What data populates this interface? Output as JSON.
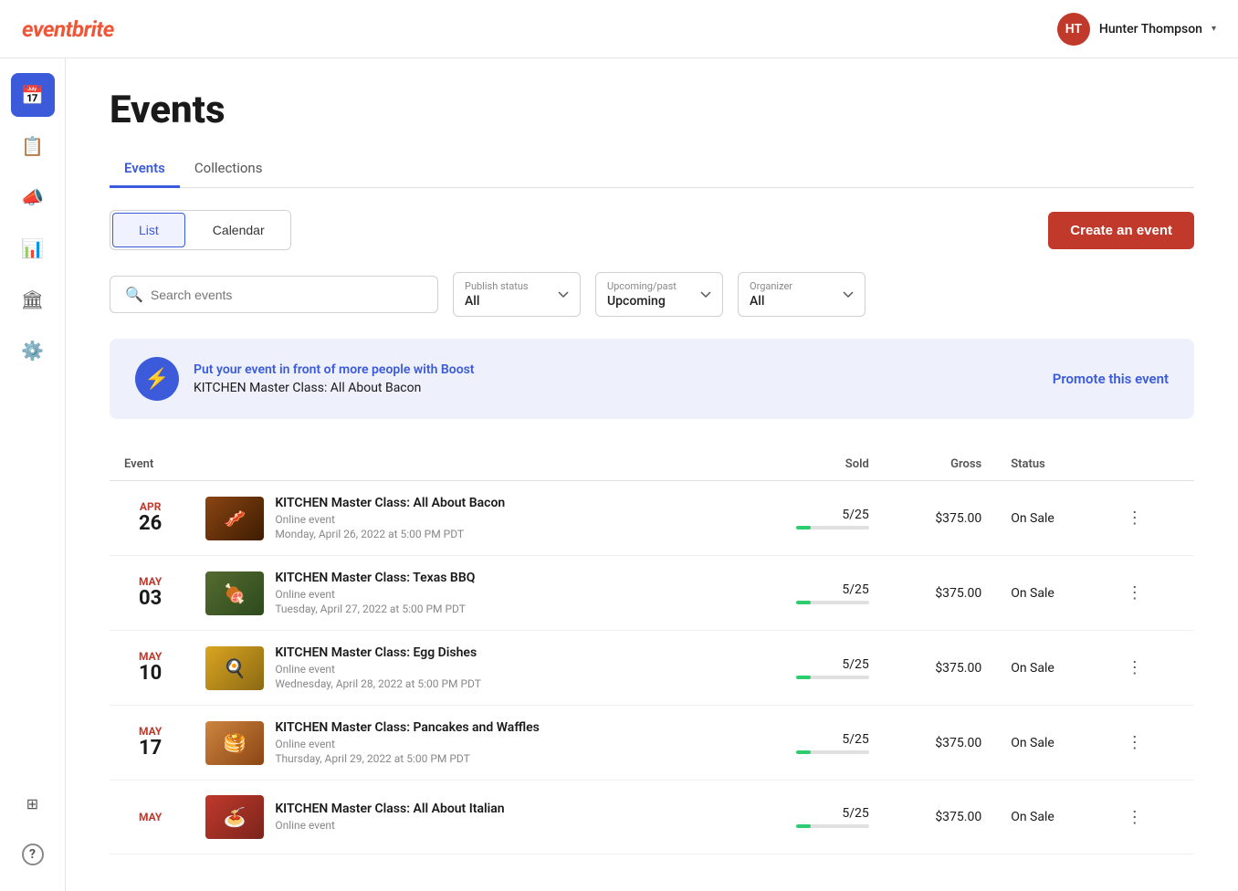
{
  "header": {
    "logo": "eventbrite",
    "user": {
      "name": "Hunter Thompson",
      "initials": "HT"
    }
  },
  "sidebar": {
    "items": [
      {
        "id": "calendar",
        "icon": "📅",
        "label": "Calendar",
        "active": true
      },
      {
        "id": "orders",
        "icon": "📋",
        "label": "Orders",
        "active": false
      },
      {
        "id": "marketing",
        "icon": "📣",
        "label": "Marketing",
        "active": false
      },
      {
        "id": "analytics",
        "icon": "📊",
        "label": "Analytics",
        "active": false
      },
      {
        "id": "finance",
        "icon": "🏛",
        "label": "Finance",
        "active": false
      },
      {
        "id": "settings",
        "icon": "⚙️",
        "label": "Settings",
        "active": false
      }
    ],
    "bottom_items": [
      {
        "id": "apps",
        "icon": "⊞",
        "label": "Apps"
      },
      {
        "id": "help",
        "icon": "?",
        "label": "Help"
      }
    ]
  },
  "page": {
    "title": "Events",
    "tabs": [
      {
        "label": "Events",
        "active": true
      },
      {
        "label": "Collections",
        "active": false
      }
    ],
    "view_toggle": {
      "list_label": "List",
      "calendar_label": "Calendar"
    },
    "create_button_label": "Create an event",
    "filters": {
      "search_placeholder": "Search events",
      "publish_status": {
        "label": "Publish status",
        "value": "All"
      },
      "upcoming_past": {
        "label": "Upcoming/past",
        "value": "Upcoming"
      },
      "organizer": {
        "label": "Organizer",
        "value": "All"
      }
    },
    "boost_banner": {
      "title": "Put your event in front of more people with Boost",
      "event_name": "KITCHEN Master Class: All About Bacon",
      "cta_label": "Promote this event"
    },
    "table": {
      "headers": {
        "event": "Event",
        "sold": "Sold",
        "gross": "Gross",
        "status": "Status"
      },
      "events": [
        {
          "month": "APR",
          "day": "26",
          "name": "KITCHEN Master Class: All About Bacon",
          "type": "Online event",
          "datetime": "Monday, April 26, 2022 at 5:00 PM PDT",
          "sold": "5/25",
          "sold_pct": 20,
          "gross": "$375.00",
          "status": "On Sale",
          "thumb_type": "bacon"
        },
        {
          "month": "MAY",
          "day": "03",
          "name": "KITCHEN Master Class: Texas BBQ",
          "type": "Online event",
          "datetime": "Tuesday, April 27, 2022 at 5:00 PM PDT",
          "sold": "5/25",
          "sold_pct": 20,
          "gross": "$375.00",
          "status": "On Sale",
          "thumb_type": "bbq"
        },
        {
          "month": "MAY",
          "day": "10",
          "name": "KITCHEN Master Class: Egg Dishes",
          "type": "Online event",
          "datetime": "Wednesday, April 28, 2022 at 5:00 PM PDT",
          "sold": "5/25",
          "sold_pct": 20,
          "gross": "$375.00",
          "status": "On Sale",
          "thumb_type": "egg"
        },
        {
          "month": "MAY",
          "day": "17",
          "name": "KITCHEN Master Class: Pancakes and Waffles",
          "type": "Online event",
          "datetime": "Thursday, April 29, 2022 at 5:00 PM PDT",
          "sold": "5/25",
          "sold_pct": 20,
          "gross": "$375.00",
          "status": "On Sale",
          "thumb_type": "pancake"
        },
        {
          "month": "MAY",
          "day": "",
          "name": "KITCHEN Master Class: All About Italian",
          "type": "Online event",
          "datetime": "",
          "sold": "5/25",
          "sold_pct": 20,
          "gross": "$375.00",
          "status": "On Sale",
          "thumb_type": "italian"
        }
      ]
    }
  }
}
